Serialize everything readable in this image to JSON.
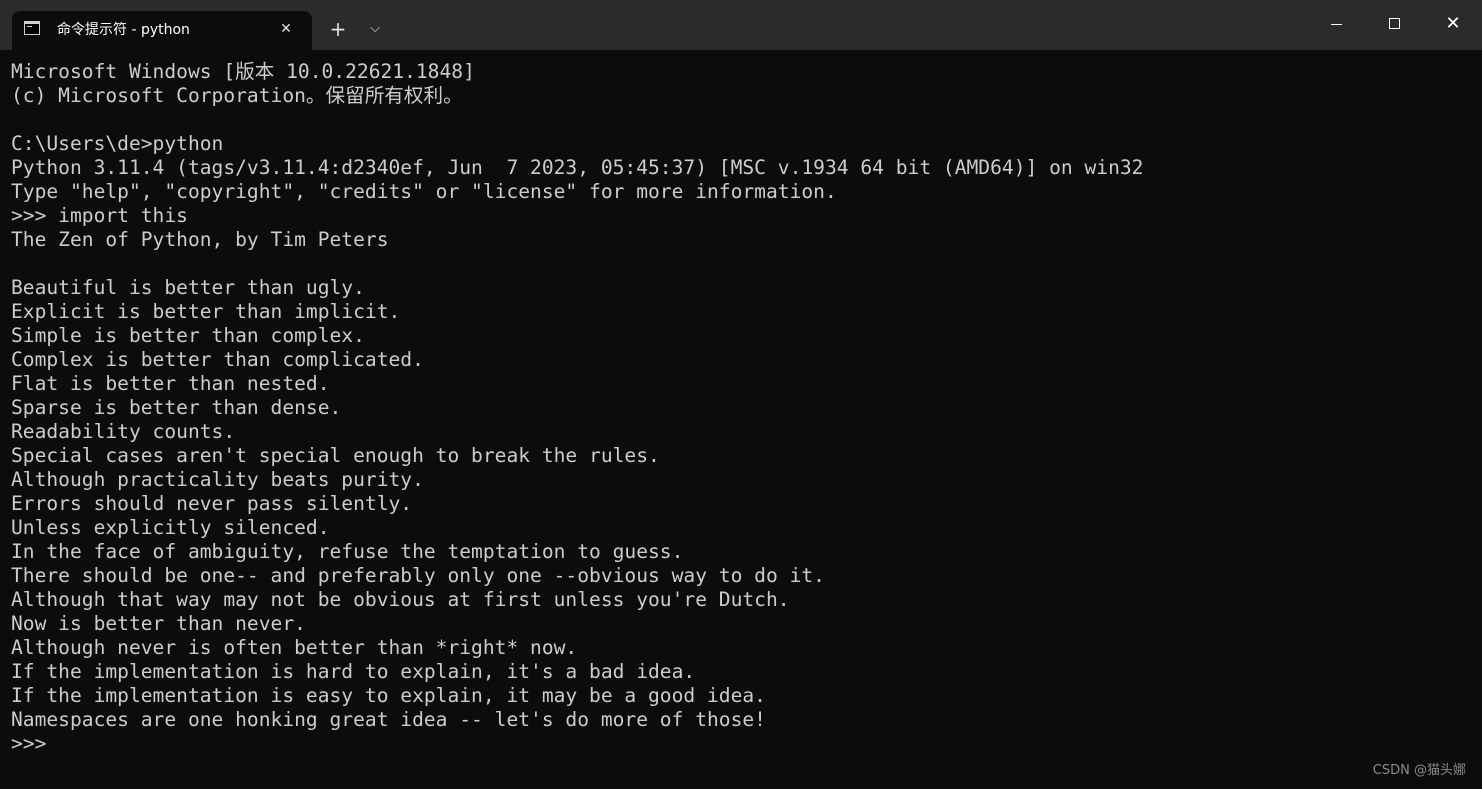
{
  "tab": {
    "title": "命令提示符 - python",
    "icon": "console-icon",
    "close_glyph": "✕"
  },
  "titlebar": {
    "new_tab_glyph": "+",
    "dropdown_glyph": "⌵",
    "close_glyph": "✕"
  },
  "console": {
    "lines": [
      "Microsoft Windows [版本 10.0.22621.1848]",
      "(c) Microsoft Corporation。保留所有权利。",
      "",
      "C:\\Users\\de>python",
      "Python 3.11.4 (tags/v3.11.4:d2340ef, Jun  7 2023, 05:45:37) [MSC v.1934 64 bit (AMD64)] on win32",
      "Type \"help\", \"copyright\", \"credits\" or \"license\" for more information.",
      ">>> import this",
      "The Zen of Python, by Tim Peters",
      "",
      "Beautiful is better than ugly.",
      "Explicit is better than implicit.",
      "Simple is better than complex.",
      "Complex is better than complicated.",
      "Flat is better than nested.",
      "Sparse is better than dense.",
      "Readability counts.",
      "Special cases aren't special enough to break the rules.",
      "Although practicality beats purity.",
      "Errors should never pass silently.",
      "Unless explicitly silenced.",
      "In the face of ambiguity, refuse the temptation to guess.",
      "There should be one-- and preferably only one --obvious way to do it.",
      "Although that way may not be obvious at first unless you're Dutch.",
      "Now is better than never.",
      "Although never is often better than *right* now.",
      "If the implementation is hard to explain, it's a bad idea.",
      "If the implementation is easy to explain, it may be a good idea.",
      "Namespaces are one honking great idea -- let's do more of those!",
      ">>>"
    ]
  },
  "watermark": "CSDN @猫头娜",
  "colors": {
    "titlebar": "#2b2b2b",
    "console_bg": "#0c0c0c",
    "console_text": "#cccccc"
  }
}
